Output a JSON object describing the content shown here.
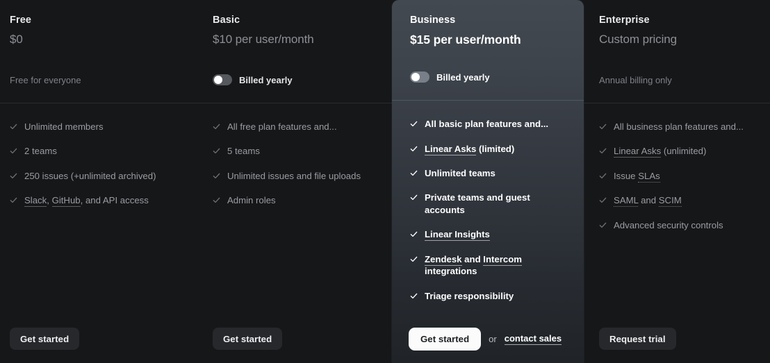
{
  "plans": [
    {
      "name": "Free",
      "price": "$0",
      "billing_note": "Free for everyone",
      "has_toggle": false,
      "toggle_label": "",
      "toggle_state": "off",
      "features": [
        {
          "parts": [
            {
              "text": "Unlimited members",
              "style": "plain"
            }
          ]
        },
        {
          "parts": [
            {
              "text": "2 teams",
              "style": "plain"
            }
          ]
        },
        {
          "parts": [
            {
              "text": "250 issues (+unlimited archived)",
              "style": "plain"
            }
          ]
        },
        {
          "parts": [
            {
              "text": "Slack",
              "style": "link"
            },
            {
              "text": ", ",
              "style": "plain"
            },
            {
              "text": "GitHub",
              "style": "link"
            },
            {
              "text": ", and API access",
              "style": "plain"
            }
          ]
        }
      ],
      "cta": {
        "label": "Get started",
        "variant": "dark"
      },
      "secondary": null
    },
    {
      "name": "Basic",
      "price": "$10 per user/month",
      "billing_note": "",
      "has_toggle": true,
      "toggle_label": "Billed yearly",
      "toggle_state": "off",
      "features": [
        {
          "parts": [
            {
              "text": "All free plan features and...",
              "style": "plain"
            }
          ]
        },
        {
          "parts": [
            {
              "text": "5 teams",
              "style": "plain"
            }
          ]
        },
        {
          "parts": [
            {
              "text": "Unlimited issues and file uploads",
              "style": "plain"
            }
          ]
        },
        {
          "parts": [
            {
              "text": "Admin roles",
              "style": "plain"
            }
          ]
        }
      ],
      "cta": {
        "label": "Get started",
        "variant": "dark"
      },
      "secondary": null
    },
    {
      "name": "Business",
      "price": "$15 per user/month",
      "billing_note": "",
      "has_toggle": true,
      "toggle_label": "Billed yearly",
      "toggle_state": "off",
      "highlighted": true,
      "features": [
        {
          "parts": [
            {
              "text": "All basic plan features and...",
              "style": "plain"
            }
          ]
        },
        {
          "parts": [
            {
              "text": "Linear Asks",
              "style": "link"
            },
            {
              "text": " (limited)",
              "style": "plain"
            }
          ]
        },
        {
          "parts": [
            {
              "text": "Unlimited teams",
              "style": "plain"
            }
          ]
        },
        {
          "parts": [
            {
              "text": "Private teams and guest accounts",
              "style": "plain"
            }
          ]
        },
        {
          "parts": [
            {
              "text": "Linear Insights",
              "style": "link"
            }
          ]
        },
        {
          "parts": [
            {
              "text": "Zendesk",
              "style": "link"
            },
            {
              "text": " and ",
              "style": "plain"
            },
            {
              "text": "Intercom",
              "style": "link"
            },
            {
              "text": " integrations",
              "style": "plain"
            }
          ]
        },
        {
          "parts": [
            {
              "text": "Triage responsibility",
              "style": "plain"
            }
          ]
        }
      ],
      "cta": {
        "label": "Get started",
        "variant": "light"
      },
      "secondary": {
        "or_text": "or",
        "link_label": "contact sales"
      }
    },
    {
      "name": "Enterprise",
      "price": "Custom pricing",
      "billing_note": "Annual billing only",
      "has_toggle": false,
      "toggle_label": "",
      "toggle_state": "off",
      "features": [
        {
          "parts": [
            {
              "text": "All business plan features and...",
              "style": "plain"
            }
          ]
        },
        {
          "parts": [
            {
              "text": "Linear Asks",
              "style": "link"
            },
            {
              "text": " (unlimited)",
              "style": "plain"
            }
          ]
        },
        {
          "parts": [
            {
              "text": "Issue ",
              "style": "plain"
            },
            {
              "text": "SLAs",
              "style": "abbr"
            }
          ]
        },
        {
          "parts": [
            {
              "text": "SAML",
              "style": "abbr"
            },
            {
              "text": " and ",
              "style": "plain"
            },
            {
              "text": "SCIM",
              "style": "abbr"
            }
          ]
        },
        {
          "parts": [
            {
              "text": "Advanced security controls",
              "style": "plain"
            }
          ]
        }
      ],
      "cta": {
        "label": "Request trial",
        "variant": "dark"
      },
      "secondary": null
    }
  ],
  "icons": {
    "check": "check-icon",
    "toggle": "toggle-switch"
  },
  "colors": {
    "page_background": "#161719",
    "highlight_card_top": "#434951",
    "highlight_card_bottom": "#202428",
    "muted_text": "#9a9ca1",
    "primary_text": "#ffffff",
    "button_dark": "#26282b",
    "button_light": "#fbfbfb",
    "divider": "#2a2b2e"
  }
}
